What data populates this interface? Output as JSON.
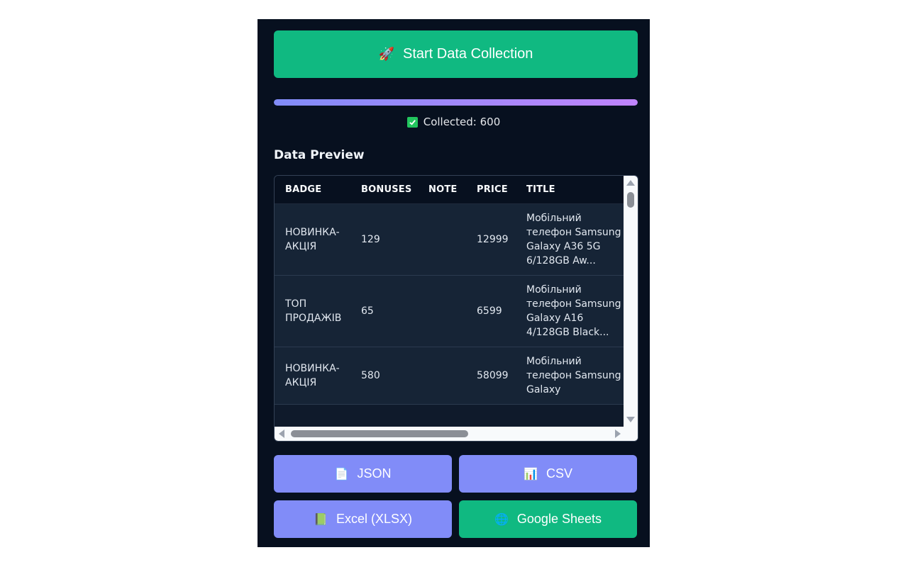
{
  "start_button": {
    "icon": "rocket-icon",
    "label": "Start Data Collection"
  },
  "progress": {
    "value": 1.0
  },
  "status": {
    "icon": "checkmark-icon",
    "text": "Collected: 600"
  },
  "preview": {
    "title": "Data Preview",
    "columns": [
      "BADGE",
      "BONUSES",
      "NOTE",
      "PRICE",
      "TITLE"
    ],
    "rows": [
      {
        "badge": "НОВИНКА-АКЦІЯ",
        "bonuses": "129",
        "note": "",
        "price": "12999",
        "title": "Мобільний телефон Samsung Galaxy A36 5G 6/128GB Aw..."
      },
      {
        "badge": "ТОП ПРОДАЖІВ",
        "bonuses": "65",
        "note": "",
        "price": "6599",
        "title": "Мобільний телефон Samsung Galaxy A16 4/128GB Black..."
      },
      {
        "badge": "НОВИНКА-АКЦІЯ",
        "bonuses": "580",
        "note": "",
        "price": "58099",
        "title": "Мобільний телефон Samsung Galaxy"
      }
    ]
  },
  "export": {
    "json": {
      "icon": "document-icon",
      "label": "JSON"
    },
    "csv": {
      "icon": "bar-chart-icon",
      "label": "CSV"
    },
    "xlsx": {
      "icon": "green-book-icon",
      "label": "Excel (XLSX)"
    },
    "gsheets": {
      "icon": "globe-icon",
      "label": "Google Sheets"
    }
  },
  "colors": {
    "panel": "#07101f",
    "accent_green": "#10b981",
    "accent_indigo": "#818cf8"
  }
}
